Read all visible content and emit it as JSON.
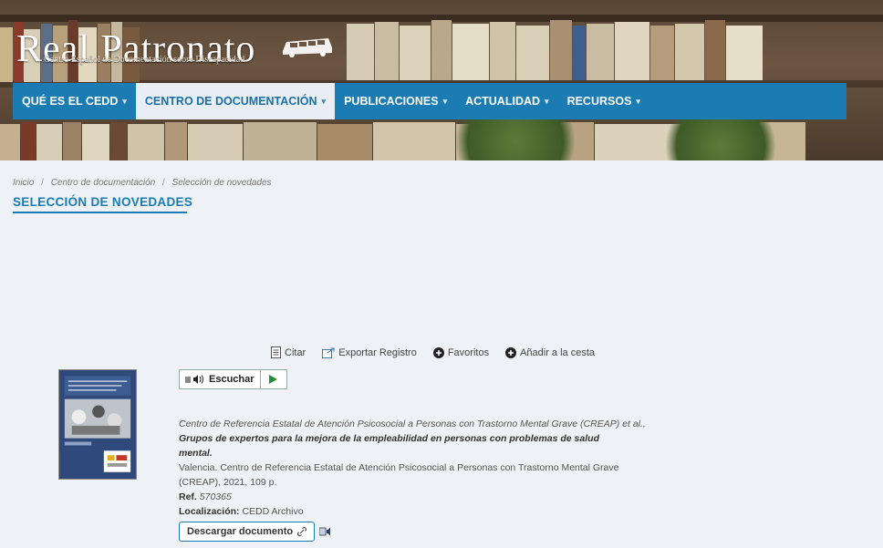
{
  "header": {
    "logo_text": "Real Patronato",
    "logo_subtitle": "Centro Español de Documentación sobre Discapacidad"
  },
  "nav": {
    "items": [
      {
        "label": "QUÉ ES EL CEDD",
        "caret": "▾"
      },
      {
        "label": "CENTRO DE DOCUMENTACIÓN",
        "caret": "▾"
      },
      {
        "label": "PUBLICACIONES",
        "caret": "▾"
      },
      {
        "label": "ACTUALIDAD",
        "caret": "▾"
      },
      {
        "label": "RECURSOS",
        "caret": "▾"
      }
    ]
  },
  "breadcrumb": [
    "Inicio",
    "Centro de documentación",
    "Selección de novedades"
  ],
  "breadcrumb_separator": "/",
  "page_title": "SELECCIÓN DE NOVEDADES",
  "toolbar": {
    "cite": "Citar",
    "export": "Exportar Registro",
    "favorites": "Favoritos",
    "add_cart": "Añadir a la cesta"
  },
  "listen": {
    "label": "Escuchar"
  },
  "record": {
    "authors": "Centro de Referencia Estatal de Atención Psicosocial a Personas con Trastorno Mental Grave (CREAP) et al.,",
    "title": "Grupos de expertos para la mejora de la empleabilidad en personas con problemas de salud mental.",
    "publisher": "Valencia. Centro de Referencia Estatal de Atención Psicosocial a Personas con Trastorno Mental Grave (CREAP), 2021, 109 p.",
    "ref_label": "Ref.",
    "ref_value": "570365",
    "location_label": "Localización:",
    "location_value": "CEDD Archivo"
  },
  "download": {
    "label": "Descargar documento"
  },
  "colors": {
    "nav_bg": "#1b7cb3",
    "accent": "#1b7cb3",
    "page_bg": "#eef1f5"
  }
}
